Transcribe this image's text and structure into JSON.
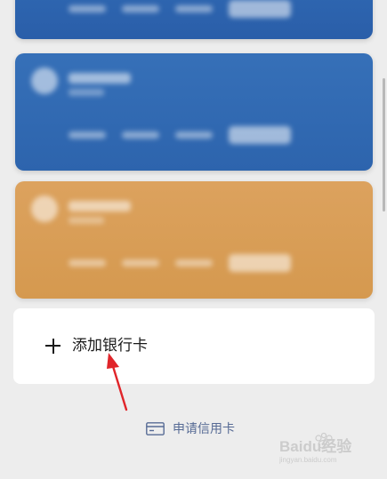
{
  "cards": [
    {
      "id": "top",
      "color": "#2f68b2"
    },
    {
      "id": "blue",
      "color": "#3670b8"
    },
    {
      "id": "gold",
      "color": "#dca25e"
    }
  ],
  "add_card": {
    "label": "添加银行卡",
    "icon": "plus-icon"
  },
  "apply_link": {
    "label": "申请信用卡",
    "icon": "credit-card-icon",
    "color": "#576b95"
  },
  "annotation": {
    "arrow_color": "#e0252a"
  },
  "watermark": {
    "text": "Baidu经验",
    "sub": "jingyan.baidu.com"
  }
}
